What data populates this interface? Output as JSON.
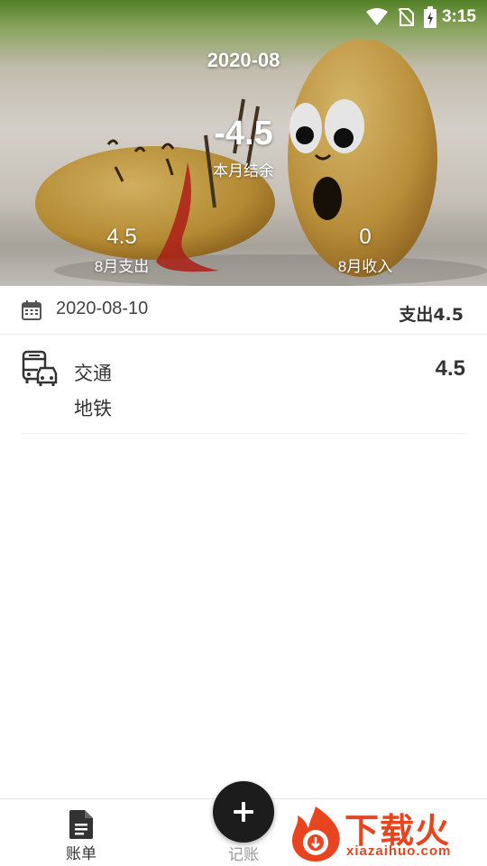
{
  "status_bar": {
    "time": "3:15"
  },
  "header": {
    "month": "2020-08",
    "balance": "-4.5",
    "balance_label": "本月结余",
    "expense_value": "4.5",
    "expense_label": "8月支出",
    "income_value": "0",
    "income_label": "8月收入"
  },
  "day_group": {
    "date": "2020-08-10",
    "total": "支出4.5"
  },
  "records": [
    {
      "category": "交通",
      "note": "地铁",
      "amount": "4.5",
      "icon": "bus-car-icon"
    }
  ],
  "bottom_nav": {
    "bill_label": "账单",
    "add_label": "记账"
  },
  "watermark": {
    "title": "下载火",
    "subtitle": "xiazaihuo.com"
  },
  "colors": {
    "text_primary": "#333333",
    "fab": "#1c1c1c",
    "watermark": "#e8441f"
  }
}
